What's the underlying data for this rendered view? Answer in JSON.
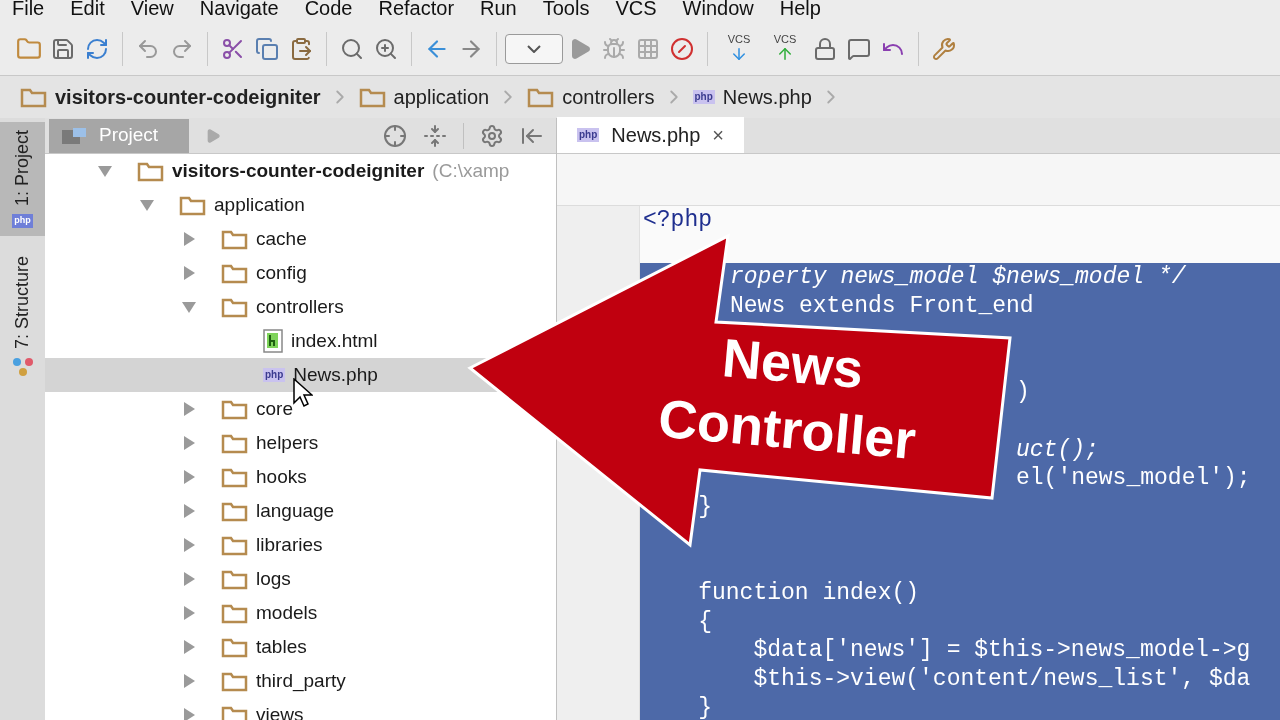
{
  "menu": [
    "File",
    "Edit",
    "View",
    "Navigate",
    "Code",
    "Refactor",
    "Run",
    "Tools",
    "VCS",
    "Window",
    "Help"
  ],
  "toolbar": {
    "vcs_labels": [
      "VCS",
      "VCS"
    ]
  },
  "breadcrumbs": [
    {
      "label": "visitors-counter-codeigniter",
      "kind": "folder",
      "bold": true
    },
    {
      "label": "application",
      "kind": "folder",
      "bold": false
    },
    {
      "label": "controllers",
      "kind": "folder",
      "bold": false
    },
    {
      "label": "News.php",
      "kind": "php",
      "icon_label": "php",
      "bold": false
    }
  ],
  "side_tabs": [
    {
      "label": "1: Project",
      "selected": true,
      "kind": "project",
      "icon_label": "php"
    },
    {
      "label": "7: Structure",
      "selected": false,
      "kind": "structure"
    }
  ],
  "project_panel": {
    "title": "Project",
    "tree": [
      {
        "label": "visitors-counter-codeigniter",
        "path": "(C:\\xamp",
        "kind": "folder",
        "expanded": true,
        "selected": false,
        "children": [
          {
            "label": "application",
            "kind": "folder",
            "expanded": true,
            "selected": false,
            "children": [
              {
                "label": "cache",
                "kind": "folder",
                "expanded": false,
                "selected": false
              },
              {
                "label": "config",
                "kind": "folder",
                "expanded": false,
                "selected": false
              },
              {
                "label": "controllers",
                "kind": "folder",
                "expanded": true,
                "selected": false,
                "children": [
                  {
                    "label": "index.html",
                    "kind": "html",
                    "selected": false
                  },
                  {
                    "label": "News.php",
                    "kind": "php",
                    "icon_label": "php",
                    "selected": true
                  }
                ]
              },
              {
                "label": "core",
                "kind": "folder",
                "expanded": false,
                "selected": false
              },
              {
                "label": "helpers",
                "kind": "folder",
                "expanded": false,
                "selected": false
              },
              {
                "label": "hooks",
                "kind": "folder",
                "expanded": false,
                "selected": false
              },
              {
                "label": "language",
                "kind": "folder",
                "expanded": false,
                "selected": false
              },
              {
                "label": "libraries",
                "kind": "folder",
                "expanded": false,
                "selected": false
              },
              {
                "label": "logs",
                "kind": "folder",
                "expanded": false,
                "selected": false
              },
              {
                "label": "models",
                "kind": "folder",
                "expanded": false,
                "selected": false
              },
              {
                "label": "tables",
                "kind": "folder",
                "expanded": false,
                "selected": false
              },
              {
                "label": "third_party",
                "kind": "folder",
                "expanded": false,
                "selected": false
              },
              {
                "label": "views",
                "kind": "folder",
                "expanded": false,
                "selected": false
              }
            ]
          }
        ]
      }
    ]
  },
  "editor": {
    "tabs": [
      {
        "label": "News.php",
        "icon_label": "php",
        "close": "×",
        "selected": true
      }
    ],
    "lines": [
      {
        "kind": "plain",
        "text": "<?php"
      },
      {
        "kind": "blank"
      },
      {
        "kind": "head",
        "text": "roperty news_model $news_model */",
        "italic": true
      },
      {
        "kind": "head",
        "text": "News extends Front_end",
        "italic": false
      },
      {
        "kind": "covered"
      },
      {
        "kind": "covered"
      },
      {
        "kind": "box",
        "text": ")",
        "italic": false
      },
      {
        "kind": "covered"
      },
      {
        "kind": "box",
        "text": "uct();",
        "italic": true
      },
      {
        "kind": "box",
        "text": "el('news_model');",
        "italic": false
      },
      {
        "kind": "selected",
        "text": "    }"
      },
      {
        "kind": "selected"
      },
      {
        "kind": "selected"
      },
      {
        "kind": "selected",
        "text": "    function index()"
      },
      {
        "kind": "selected",
        "text": "    {"
      },
      {
        "kind": "selected",
        "text": "        $data['news'] = $this->news_model->g"
      },
      {
        "kind": "selected",
        "text": "        $this->view('content/news_list', $da"
      },
      {
        "kind": "selected",
        "text": "    }"
      }
    ]
  },
  "callout": {
    "lines": [
      "News",
      "Controller"
    ]
  }
}
